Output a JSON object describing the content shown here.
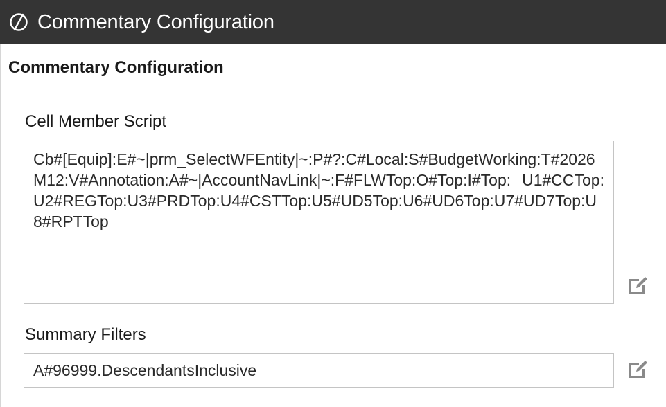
{
  "window": {
    "title": "Commentary Configuration",
    "logo_icon": "onestream-logo-icon"
  },
  "section": {
    "title": "Commentary Configuration"
  },
  "cell_member_script": {
    "label": "Cell Member Script",
    "value": "Cb#[Equip]:E#~|prm_SelectWFEntity|~:P#?:C#Local:S#BudgetWorking:T#2026M12:V#Annotation:A#~|AccountNavLink|~:F#FLWTop:O#Top:I#Top: U1#CCTop: U2#REGTop:U3#PRDTop:U4#CSTTop:U5#UD5Top:U6#UD6Top:U7#UD7Top:U8#RPTTop",
    "edit_icon": "edit-icon"
  },
  "summary_filters": {
    "label": "Summary Filters",
    "value": "A#96999.DescendantsInclusive",
    "edit_icon": "edit-icon"
  },
  "colors": {
    "titlebar_bg": "#343434",
    "titlebar_text": "#ffffff",
    "border": "#c4c4c4",
    "icon_gray": "#8a8a8a"
  }
}
